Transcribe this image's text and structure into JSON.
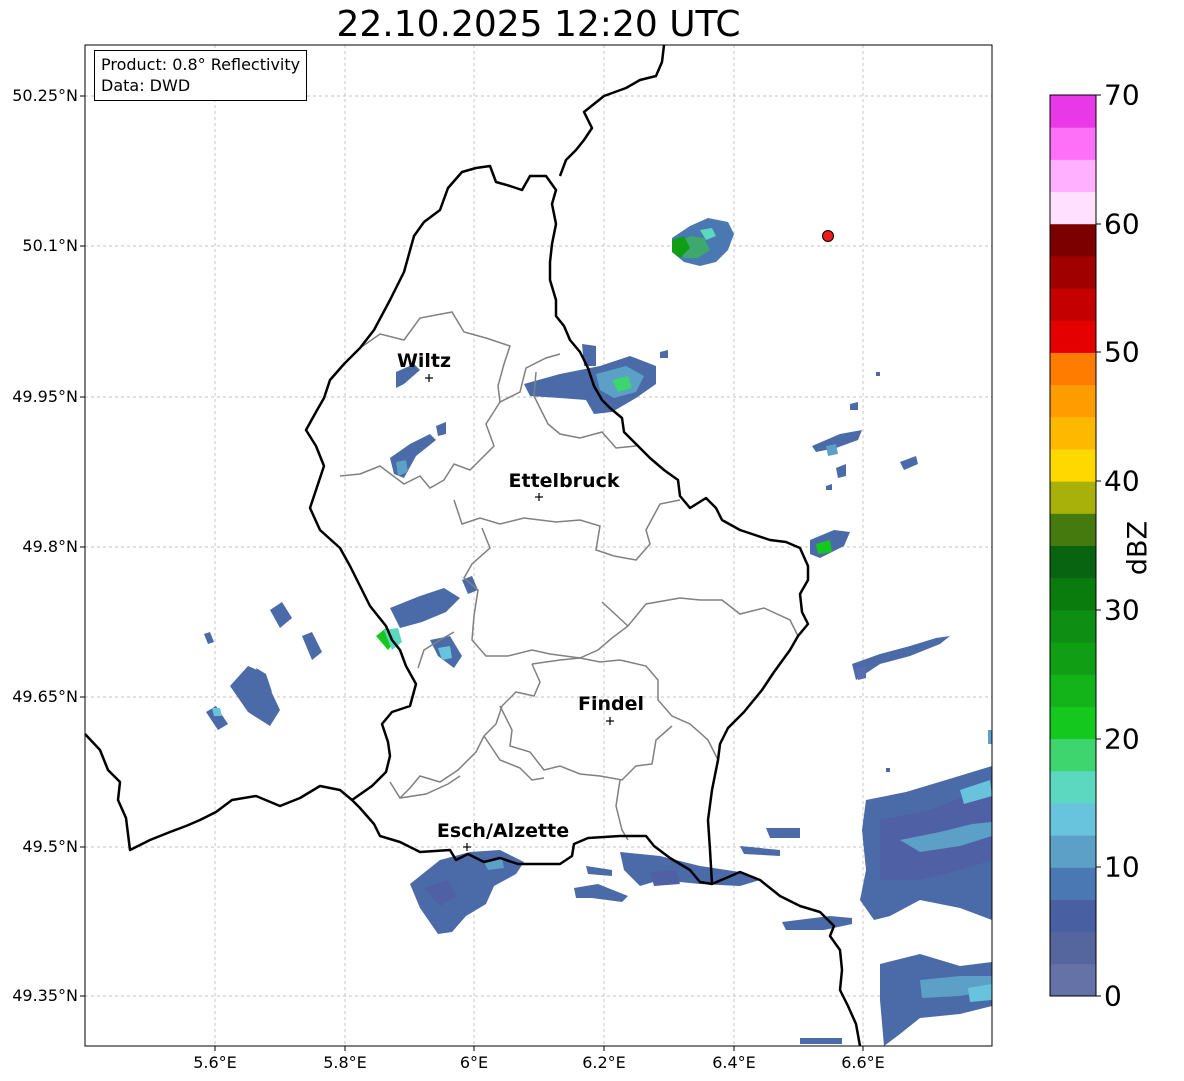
{
  "title": "22.10.2025 12:20 UTC",
  "info_box": {
    "product": "Product: 0.8° Reflectivity",
    "data": "Data: DWD"
  },
  "y_axis_labels": [
    "50.25°N",
    "50.1°N",
    "49.95°N",
    "49.8°N",
    "49.65°N",
    "49.5°N",
    "49.35°N"
  ],
  "x_axis_labels": [
    "5.6°E",
    "5.8°E",
    "6°E",
    "6.2°E",
    "6.4°E",
    "6.6°E"
  ],
  "cities": [
    {
      "name": "Wiltz"
    },
    {
      "name": "Ettelbruck"
    },
    {
      "name": "Findel"
    },
    {
      "name": "Esch/Alzette"
    }
  ],
  "colorbar": {
    "label": "dBZ",
    "ticks": [
      "0",
      "10",
      "20",
      "30",
      "40",
      "50",
      "60",
      "70"
    ],
    "colors": [
      "#6472a8",
      "#55659e",
      "#4860a2",
      "#4a78b2",
      "#5ca0c8",
      "#68c4dc",
      "#5cd8c0",
      "#3ed46e",
      "#14c81e",
      "#12b41a",
      "#109e14",
      "#0e8e12",
      "#0a7c0e",
      "#086410",
      "#447a0e",
      "#a8b00a",
      "#ffd800",
      "#ffb800",
      "#ff9c00",
      "#ff7c00",
      "#e40000",
      "#c40000",
      "#a00000",
      "#7c0000",
      "#ffe0ff",
      "#ffb0ff",
      "#ff70f8",
      "#e838e8"
    ]
  },
  "map_extent": {
    "lon": [
      5.4,
      6.8
    ],
    "lat": [
      49.3,
      50.3
    ]
  }
}
